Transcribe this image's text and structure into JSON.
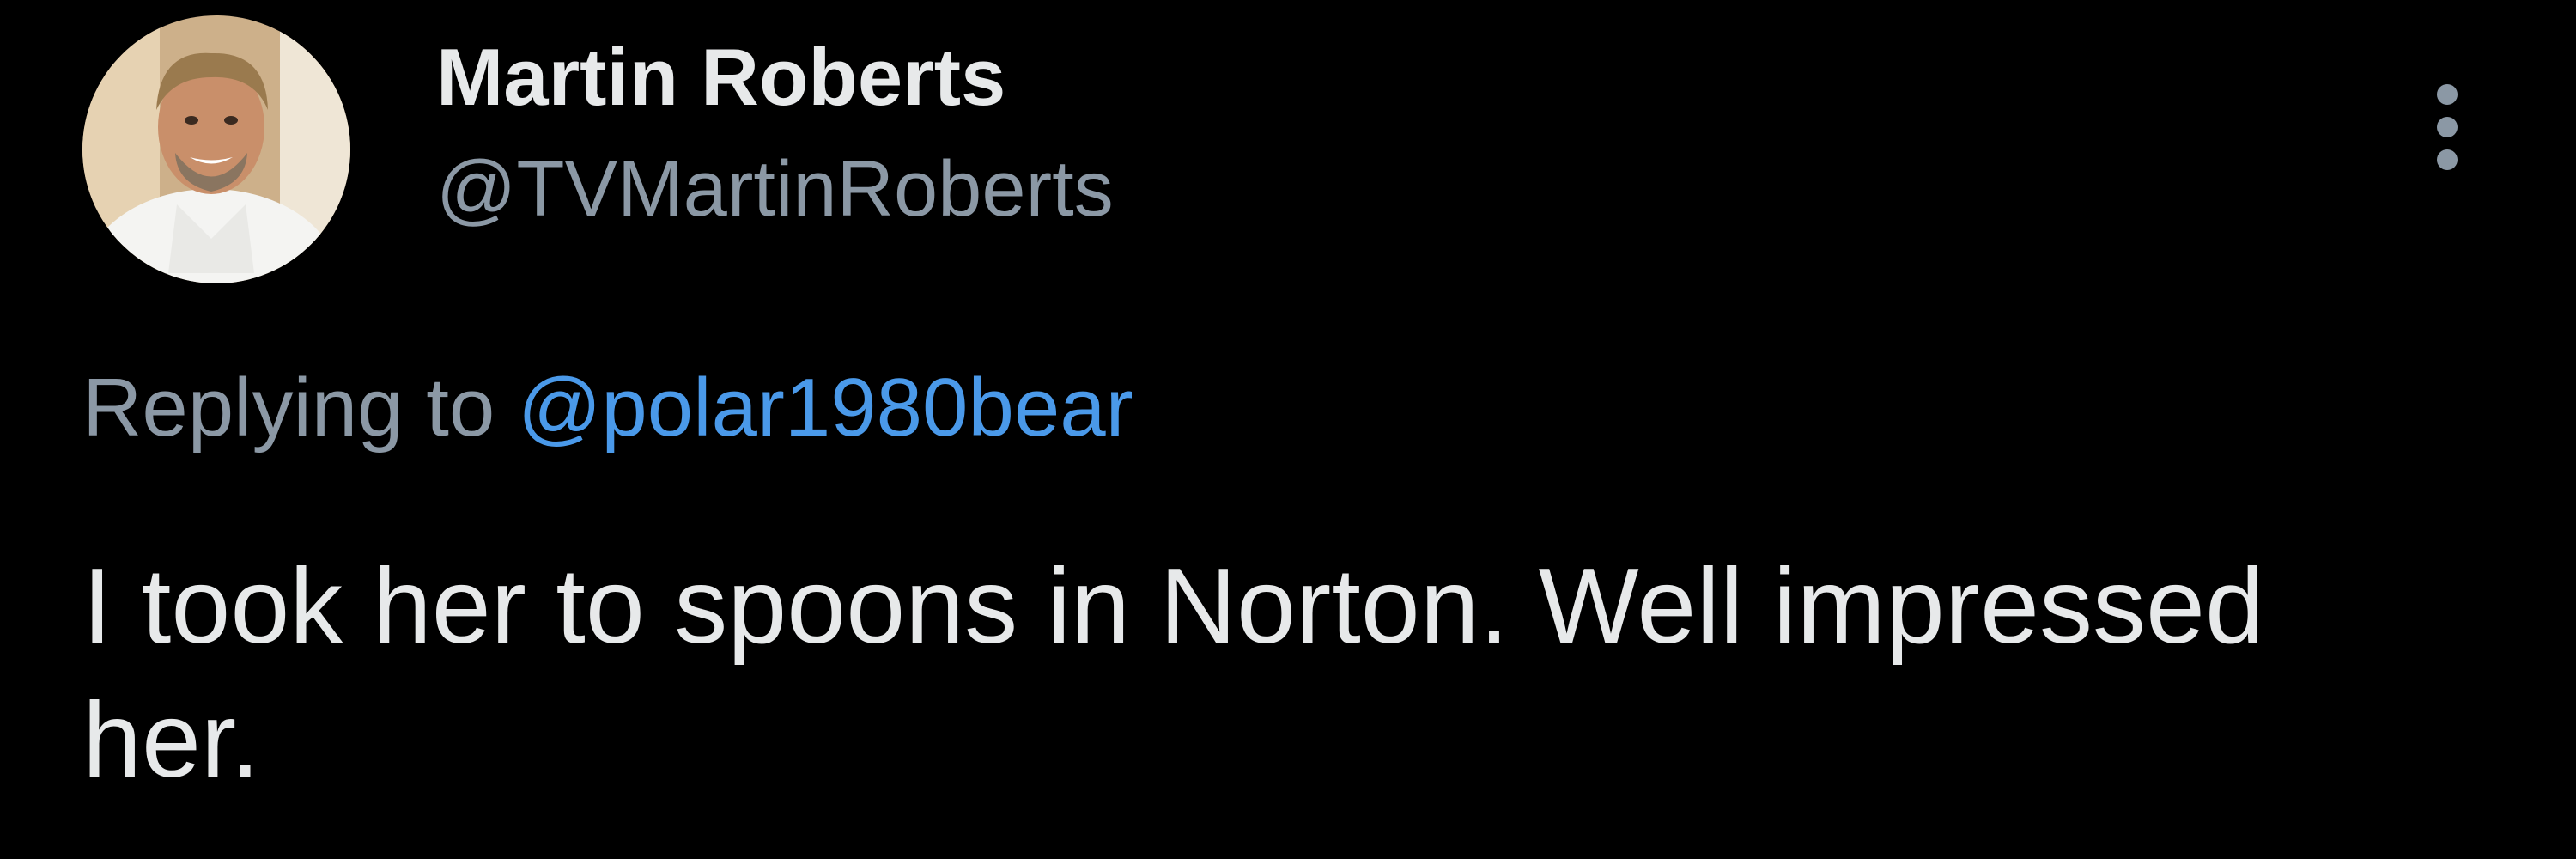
{
  "tweet": {
    "author": {
      "display_name": "Martin Roberts",
      "handle": "@TVMartinRoberts",
      "avatar": "profile-photo"
    },
    "more_icon": "more-vertical-icon",
    "reply": {
      "prefix": "Replying to",
      "mention": "@polar1980bear"
    },
    "text": "I took her to spoons in Norton. Well impressed her."
  },
  "colors": {
    "background": "#000000",
    "primary_text": "#e7e9ea",
    "secondary_text": "#8b98a5",
    "link": "#4a99e9"
  }
}
